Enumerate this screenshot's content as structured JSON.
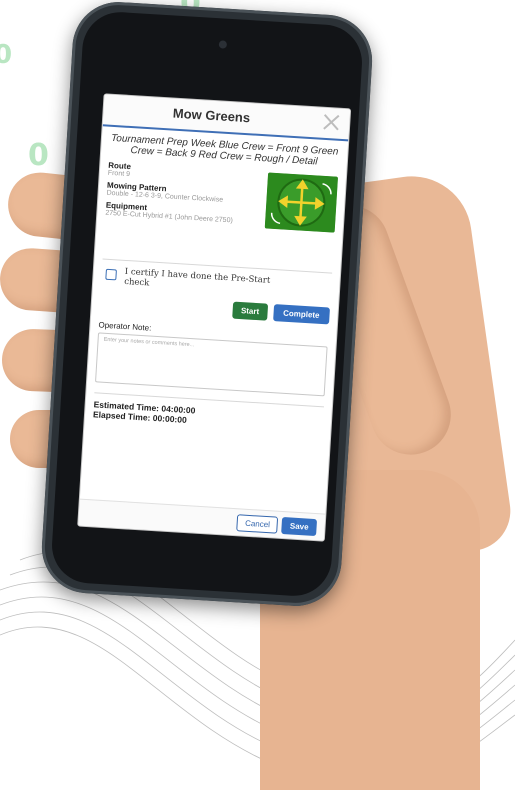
{
  "background": {
    "digits": [
      "0",
      "0",
      "0"
    ],
    "accent_color": "#b9e6c2"
  },
  "dialog": {
    "title": "Mow Greens",
    "close_icon": "close-icon",
    "subtitle": "Tournament Prep Week Blue Crew = Front 9 Green Crew = Back 9 Red Crew = Rough / Detail",
    "route": {
      "label": "Route",
      "value": "Front 9"
    },
    "mowing_pattern": {
      "label": "Mowing Pattern",
      "value": "Double - 12-6 3-9, Counter Clockwise"
    },
    "equipment": {
      "label": "Equipment",
      "value": "2750 E-Cut Hybrid #1 (John Deere 2750)"
    },
    "pattern_image_icon": "mowing-pattern-diagram",
    "certify_text": "I certify I have done the Pre-Start check",
    "certify_checked": false,
    "start_label": "Start",
    "complete_label": "Complete",
    "operator_note_label": "Operator Note:",
    "notes_placeholder": "Enter your notes or comments here...",
    "estimated_time": "Estimated Time: 04:00:00",
    "elapsed_time": "Elapsed Time: 00:00:00",
    "cancel_label": "Cancel",
    "save_label": "Save",
    "colors": {
      "primary": "#3570c2",
      "start": "#2a7b3d",
      "green_image": "#2c8a1e"
    }
  }
}
